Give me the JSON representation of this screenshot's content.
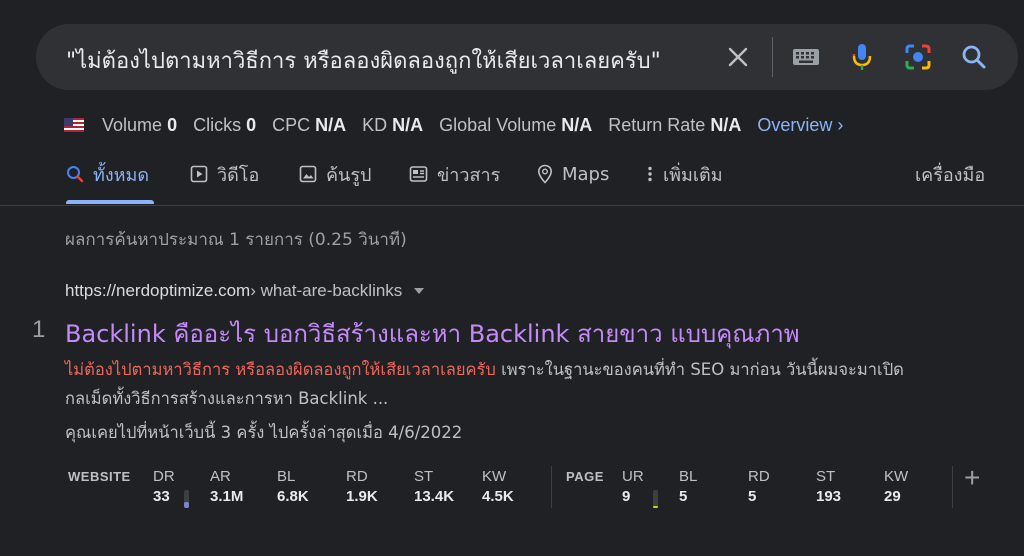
{
  "search": {
    "query": "\"ไม่ต้องไปตามหาวิธีการ หรือลองผิดลองถูกให้เสียเวลาเลยครับ\"",
    "icons": [
      "close-icon",
      "keyboard-icon",
      "microphone-icon",
      "camera-lens-icon",
      "search-icon"
    ]
  },
  "metrics": {
    "volume_label": "Volume",
    "volume": "0",
    "clicks_label": "Clicks",
    "clicks": "0",
    "cpc_label": "CPC",
    "cpc": "N/A",
    "kd_label": "KD",
    "kd": "N/A",
    "global_label": "Global Volume",
    "global": "N/A",
    "return_label": "Return Rate",
    "return": "N/A",
    "overview": "Overview ›"
  },
  "tabs": {
    "all": "ทั้งหมด",
    "videos": "วิดีโอ",
    "images": "ค้นรูป",
    "news": "ข่าวสาร",
    "maps": "Maps",
    "more": "เพิ่มเติม",
    "tools": "เครื่องมือ"
  },
  "result_stats": "ผลการค้นหาประมาณ 1 รายการ (0.25 วินาที)",
  "result": {
    "rank": "1",
    "domain": "https://nerdoptimize.com",
    "path": " › what-are-backlinks",
    "title": "Backlink คืออะไร บอกวิธีสร้างและหา Backlink สายขาว แบบคุณภาพ",
    "snippet_highlight": "ไม่ต้องไปตามหาวิธีการ หรือลองผิดลองถูกให้เสียเวลาเลยครับ",
    "snippet_rest": " เพราะในฐานะของคนที่ทำ SEO มาก่อน วันนี้ผมจะมาเปิดกลเม็ดทั้งวิธีการสร้างและการหา Backlink ...",
    "visited": "คุณเคยไปที่หน้าเว็บนี้ 3 ครั้ง ไปครั้งล่าสุดเมื่อ 4/6/2022"
  },
  "seo_bar": {
    "website_label": "WEBSITE",
    "website": [
      {
        "k": "DR",
        "v": "33",
        "level": 0.33
      },
      {
        "k": "AR",
        "v": "3.1M"
      },
      {
        "k": "BL",
        "v": "6.8K"
      },
      {
        "k": "RD",
        "v": "1.9K"
      },
      {
        "k": "ST",
        "v": "13.4K"
      },
      {
        "k": "KW",
        "v": "4.5K"
      }
    ],
    "page_label": "PAGE",
    "page": [
      {
        "k": "UR",
        "v": "9",
        "level": 0.09
      },
      {
        "k": "BL",
        "v": "5"
      },
      {
        "k": "RD",
        "v": "5"
      },
      {
        "k": "ST",
        "v": "193"
      },
      {
        "k": "KW",
        "v": "29"
      }
    ],
    "add": "+"
  },
  "colors": {
    "background": "#202124",
    "link_visited": "#c58af9",
    "accent": "#8ab4f8",
    "highlight": "#ee675c"
  }
}
